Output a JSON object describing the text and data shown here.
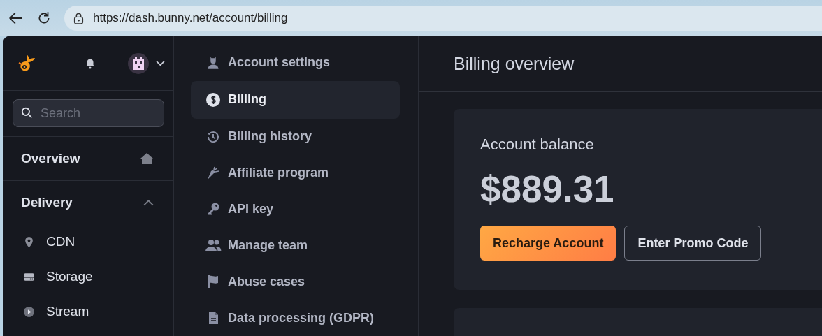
{
  "browser": {
    "url": "https://dash.bunny.net/account/billing"
  },
  "sidebar": {
    "search": {
      "placeholder": "Search"
    },
    "sections": [
      {
        "label": "Overview",
        "kind": "link"
      },
      {
        "label": "Delivery",
        "kind": "group",
        "expanded": true,
        "items": [
          {
            "label": "CDN"
          },
          {
            "label": "Storage"
          },
          {
            "label": "Stream"
          }
        ]
      }
    ]
  },
  "account_menu": [
    {
      "label": "Account settings",
      "selected": false
    },
    {
      "label": "Billing",
      "selected": true
    },
    {
      "label": "Billing history",
      "selected": false
    },
    {
      "label": "Affiliate program",
      "selected": false
    },
    {
      "label": "API key",
      "selected": false
    },
    {
      "label": "Manage team",
      "selected": false
    },
    {
      "label": "Abuse cases",
      "selected": false
    },
    {
      "label": "Data processing (GDPR)",
      "selected": false
    }
  ],
  "main": {
    "title": "Billing overview",
    "balance_card": {
      "title": "Account balance",
      "amount": "$889.31",
      "buttons": [
        {
          "label": "Recharge Account",
          "kind": "primary"
        },
        {
          "label": "Enter Promo Code",
          "kind": "secondary"
        }
      ]
    }
  }
}
